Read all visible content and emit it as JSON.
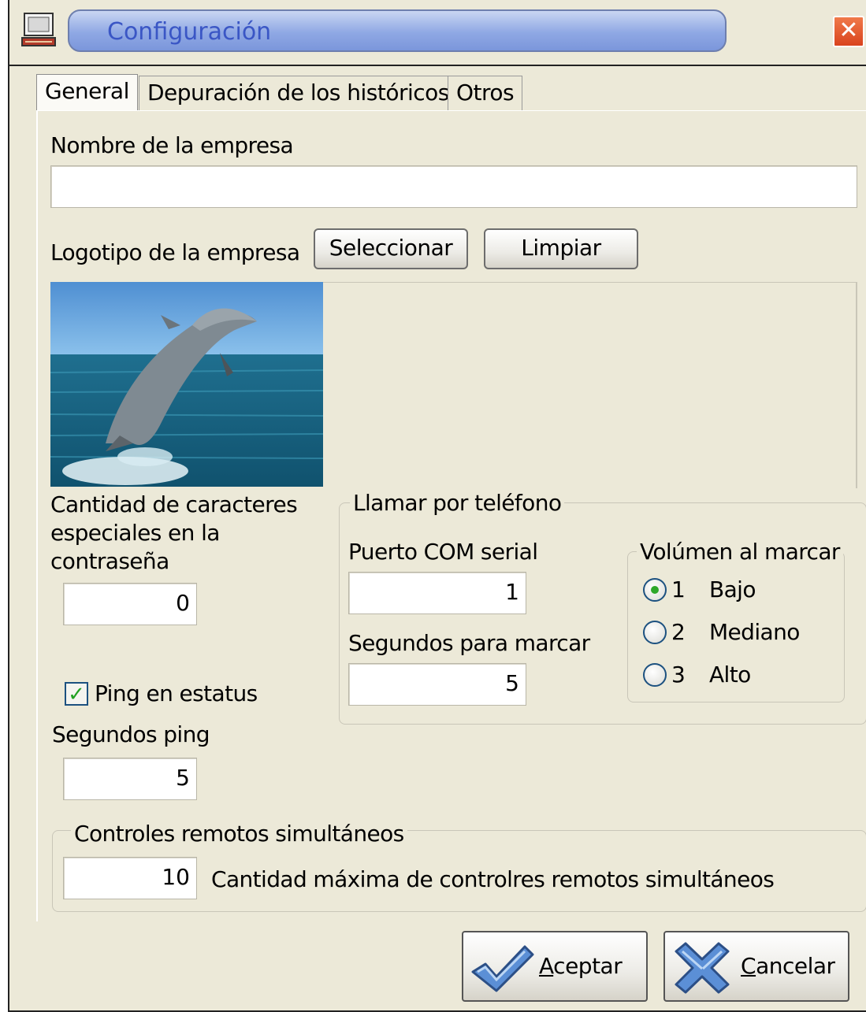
{
  "window": {
    "title": "Configuración",
    "close_glyph": "✕"
  },
  "tabs": [
    {
      "label": "General",
      "active": true
    },
    {
      "label": "Depuración de los históricos",
      "active": false
    },
    {
      "label": "Otros",
      "active": false
    }
  ],
  "general": {
    "company_name_label": "Nombre de la empresa",
    "company_name_value": "",
    "logo_label": "Logotipo de la empresa",
    "select_button": "Seleccionar",
    "clear_button": "Limpiar",
    "logo_image": "dolphin-photo",
    "special_chars_label_1": "Cantidad de caracteres",
    "special_chars_label_2": "especiales en la",
    "special_chars_label_3": "contraseña",
    "special_chars_value": "0",
    "ping_checkbox_label": "Ping en estatus",
    "ping_checked": true,
    "ping_seconds_label": "Segundos ping",
    "ping_seconds_value": "5"
  },
  "phone": {
    "group_label": "Llamar por teléfono",
    "com_port_label": "Puerto COM serial",
    "com_port_value": "1",
    "dial_seconds_label": "Segundos para marcar",
    "dial_seconds_value": "5",
    "volume_group_label": "Volúmen al marcar",
    "volume_options": [
      {
        "number": "1",
        "label": "Bajo",
        "selected": true
      },
      {
        "number": "2",
        "label": "Mediano",
        "selected": false
      },
      {
        "number": "3",
        "label": "Alto",
        "selected": false
      }
    ]
  },
  "remote": {
    "group_label": "Controles remotos simultáneos",
    "value": "10",
    "description": "Cantidad máxima de controlres remotos simultáneos"
  },
  "footer": {
    "accept_first": "A",
    "accept_rest": "ceptar",
    "cancel_first": "C",
    "cancel_rest": "ancelar"
  },
  "colors": {
    "window_bg": "#ece9d8",
    "title_text": "#3a56c5",
    "close_red": "#d9431e",
    "check_green": "#21a121"
  }
}
